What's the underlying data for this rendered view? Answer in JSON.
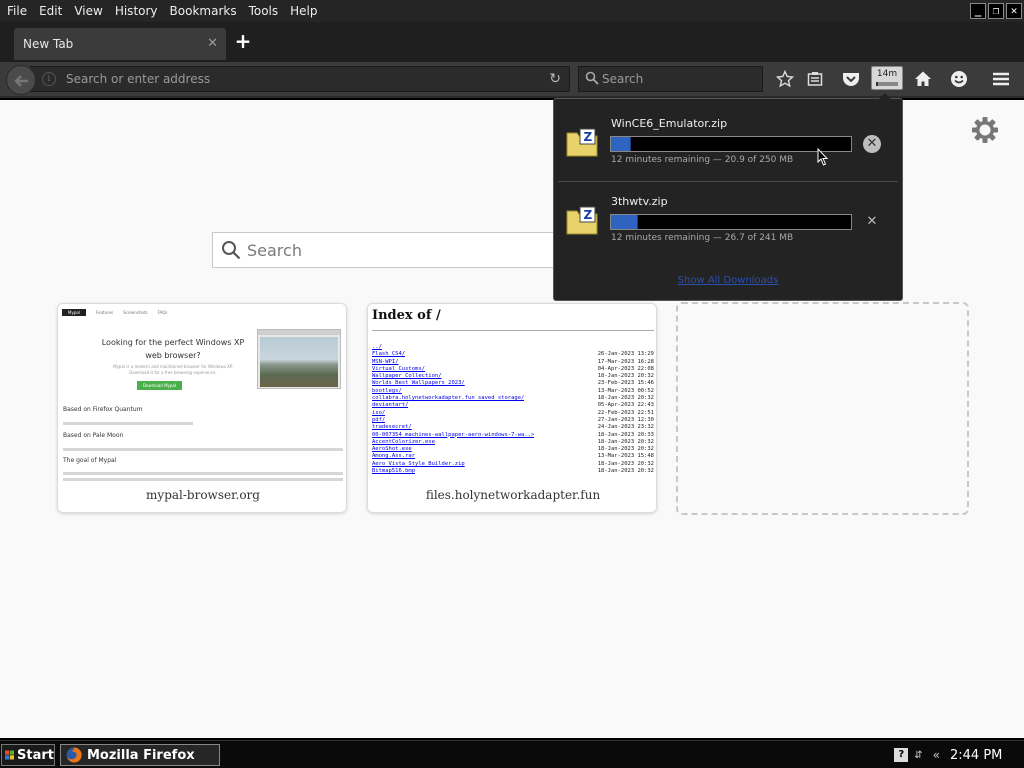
{
  "menubar": {
    "items": [
      "File",
      "Edit",
      "View",
      "History",
      "Bookmarks",
      "Tools",
      "Help"
    ],
    "window_controls": [
      "minimize",
      "restore",
      "close"
    ]
  },
  "tabs": [
    {
      "label": "New Tab",
      "active": true
    }
  ],
  "navbar": {
    "url_placeholder": "Search or enter address",
    "search_placeholder": "Search",
    "downloads_time": "14m",
    "downloads_progress_fraction": 0.09,
    "icons": [
      "back-icon",
      "info-icon",
      "reload-icon",
      "search-icon",
      "bookmark-star-icon",
      "reading-list-icon",
      "pocket-icon",
      "downloads-icon",
      "home-icon",
      "emoji-icon",
      "hamburger-menu-icon"
    ]
  },
  "newtab": {
    "search_placeholder": "Search",
    "tiles": [
      {
        "title": "mypal-browser.org"
      },
      {
        "title": "files.holynetworkadapter.fun"
      },
      {
        "title": ""
      }
    ]
  },
  "thumb_mypal": {
    "nav": [
      "Mypal",
      "Features",
      "Screenshots",
      "FAQs"
    ],
    "headline": "Looking for the perfect Windows XP web browser?",
    "sub": "Mypal is a modern and maintained browser for Windows XP. Download it for a free browsing experience.",
    "download_button": "Download Mypal",
    "heading_1": "Based on Firefox Quantum",
    "heading_2": "Based on Pale Moon",
    "heading_3": "The goal of Mypal"
  },
  "thumb_files": {
    "title": "Index of /",
    "parent": "../",
    "rows": [
      {
        "name": "Flash CS4/",
        "date": "26-Jan-2023 13:29"
      },
      {
        "name": "MSN-WPI/",
        "date": "17-Mar-2023 16:28"
      },
      {
        "name": "Virtual Customs/",
        "date": "04-Apr-2023 22:08"
      },
      {
        "name": "Wallpaper Collection/",
        "date": "18-Jan-2023 20:32"
      },
      {
        "name": "Worlds Best Wallpapers 2023/",
        "date": "23-Feb-2023 15:46"
      },
      {
        "name": "bootlegs/",
        "date": "13-Mar-2023 00:52"
      },
      {
        "name": "collabra.holynetworkadapter.fun saved storage/",
        "date": "18-Jan-2023 20:32"
      },
      {
        "name": "deviantart/",
        "date": "05-Apr-2023 22:43"
      },
      {
        "name": "iso/",
        "date": "22-Feb-2023 22:51"
      },
      {
        "name": "pdf/",
        "date": "27-Jan-2023 12:30"
      },
      {
        "name": "tradesecret/",
        "date": "24-Jan-2023 23:32"
      },
      {
        "name": "00-007354 machines-wallpaper-aero-windows-7-wa..>",
        "date": "18-Jan-2023 20:33"
      },
      {
        "name": "AccentColorizer.exe",
        "date": "18-Jan-2023 20:32"
      },
      {
        "name": "AeroShot.exe",
        "date": "18-Jan-2023 20:32"
      },
      {
        "name": "Among.Ass.rar",
        "date": "13-Mar-2023 15:48"
      },
      {
        "name": "Aero Vista Style Builder.zip",
        "date": "18-Jan-2023 20:32"
      },
      {
        "name": "Bitmap516.bmp",
        "date": "18-Jan-2023 20:32"
      }
    ]
  },
  "downloads_panel": {
    "items": [
      {
        "name": "WinCE6_Emulator.zip",
        "status": "12 minutes remaining — 20.9 of 250 MB",
        "progress": 0.084,
        "icon": "zip-folder-icon"
      },
      {
        "name": "3thwtv.zip",
        "status": "12 minutes remaining — 26.7 of 241 MB",
        "progress": 0.111,
        "icon": "zip-folder-icon"
      }
    ],
    "show_all": "Show All Downloads"
  },
  "taskbar": {
    "start_label": "Start",
    "task_label": "Mozilla Firefox",
    "tray_expand": "«",
    "help_icon": "?",
    "clock": "2:44 PM"
  },
  "colors": {
    "chrome_dark": "#3b3b3b",
    "progress_blue": "#2f63c0",
    "link_blue": "#0000ee",
    "content_bg": "#f9f9f9"
  }
}
